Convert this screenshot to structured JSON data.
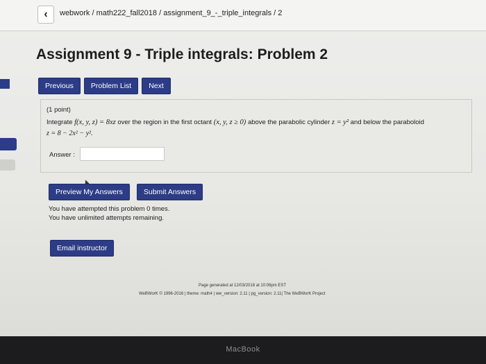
{
  "nav": {
    "back_glyph": "‹",
    "breadcrumb": "webwork / math222_fall2018 / assignment_9_-_triple_integrals / 2"
  },
  "page": {
    "title": "Assignment 9 - Triple integrals: Problem 2"
  },
  "buttons": {
    "previous": "Previous",
    "problem_list": "Problem List",
    "next": "Next",
    "preview": "Preview My Answers",
    "submit": "Submit Answers",
    "email": "Email instructor"
  },
  "problem": {
    "points": "(1 point)",
    "text_a": "Integrate ",
    "math_f": "f(x, y, z) = 8xz",
    "text_b": " over the region in the first octant ",
    "math_octant": "(x, y, z ≥ 0)",
    "text_c": " above the parabolic cylinder ",
    "math_cyl": "z = y²",
    "text_d": " and below the paraboloid",
    "line2": "z = 8 − 2x² − y².",
    "answer_label": "Answer :",
    "answer_value": ""
  },
  "status": {
    "attempts": "You have attempted this problem 0 times.",
    "remaining": "You have unlimited attempts remaining."
  },
  "footer": {
    "generated": "Page generated at 12/03/2018 at 10:06pm EST",
    "credits": "WeBWorK © 1996-2016 | theme: math4 | ww_version: 2.11 | pg_version: 2.11| The WeBWorK Project"
  },
  "device": {
    "label": "MacBook"
  },
  "colors": {
    "button_bg": "#2d3c86"
  }
}
